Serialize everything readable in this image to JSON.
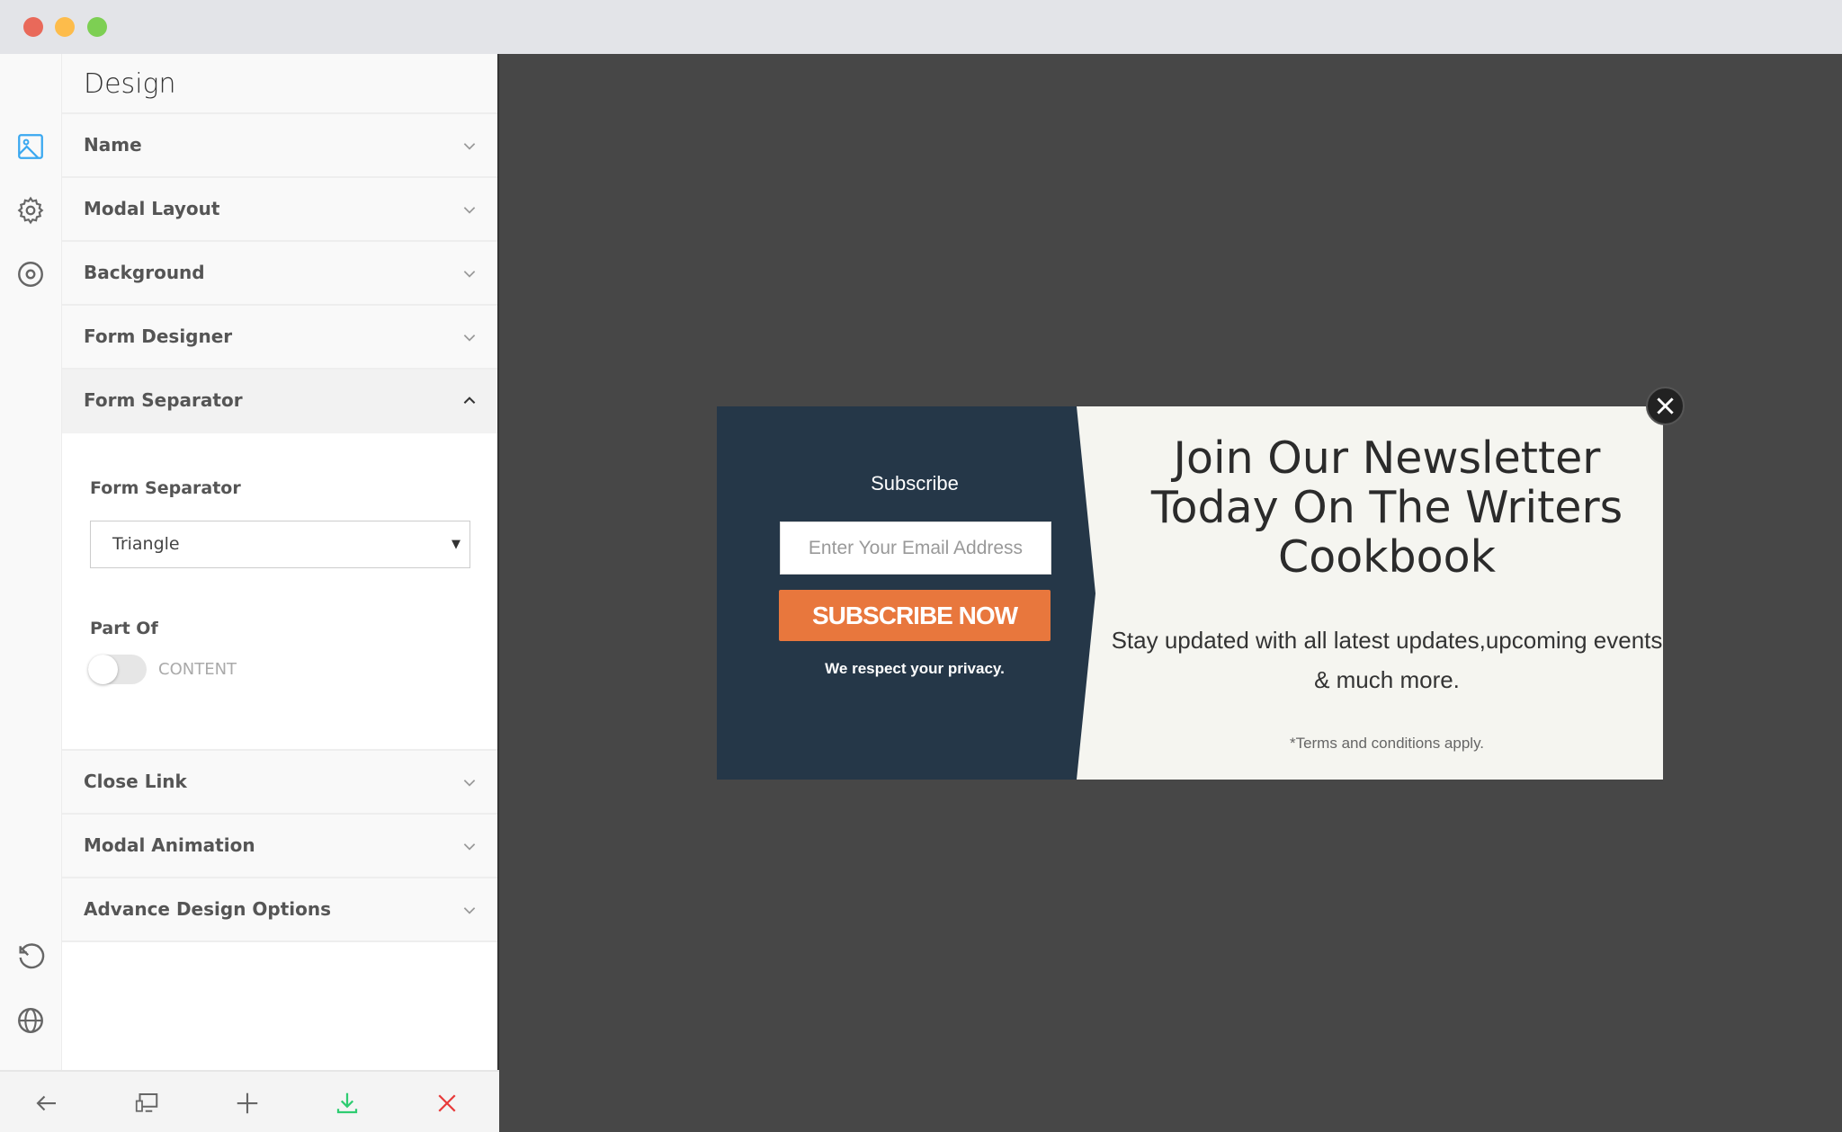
{
  "window": {
    "controls": {
      "close_color": "#e9695a",
      "minimize_color": "#fdbc4b",
      "maximize_color": "#7dcf53"
    }
  },
  "rail": {
    "icons": [
      "image-icon",
      "gear-icon",
      "target-icon",
      "history-icon",
      "globe-icon"
    ],
    "accent": "#3aa8f0"
  },
  "panel": {
    "title": "Design",
    "sections": [
      {
        "label": "Name",
        "expanded": false
      },
      {
        "label": "Modal Layout",
        "expanded": false
      },
      {
        "label": "Background",
        "expanded": false
      },
      {
        "label": "Form Designer",
        "expanded": false
      },
      {
        "label": "Form Separator",
        "expanded": true
      },
      {
        "label": "Close Link",
        "expanded": false
      },
      {
        "label": "Modal Animation",
        "expanded": false
      },
      {
        "label": "Advance Design Options",
        "expanded": false
      }
    ],
    "form_separator": {
      "field_label": "Form Separator",
      "select_value": "Triangle",
      "part_of_label": "Part Of",
      "toggle_label": "CONTENT",
      "toggle_on": false
    }
  },
  "toolbar": {
    "icons": [
      "back-arrow-icon",
      "devices-icon",
      "plus-icon",
      "download-icon",
      "close-x-icon"
    ],
    "download_color": "#2ecc71",
    "close_color": "#e83a3a"
  },
  "modal": {
    "left_bg": "#253748",
    "right_bg": "#f5f5f0",
    "subscribe_heading": "Subscribe",
    "email_placeholder": "Enter Your Email Address",
    "button_label": "SUBSCRIBE NOW",
    "button_color": "#e8773d",
    "privacy": "We respect your privacy.",
    "headline": "Join Our Newsletter Today On The Writers Cookbook",
    "subtext": "Stay updated with all latest updates,upcoming events & much more.",
    "terms": "*Terms and conditions apply."
  }
}
